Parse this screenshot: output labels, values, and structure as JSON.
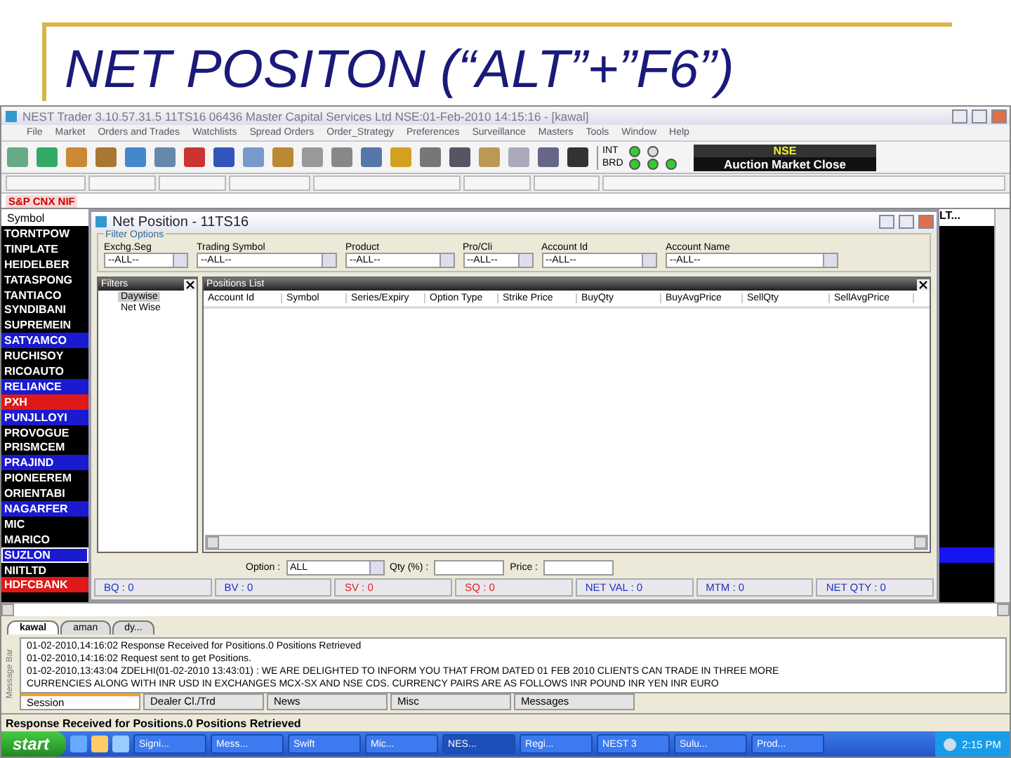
{
  "slide": {
    "title": "NET POSITON (“ALT”+”F6”)"
  },
  "window": {
    "title": "NEST Trader 3.10.57.31.5 11TS16 06436 Master Capital Services Ltd NSE:01-Feb-2010 14:15:16 - [kawal]"
  },
  "menu": [
    "File",
    "Market",
    "Orders and Trades",
    "Watchlists",
    "Spread Orders",
    "Order_Strategy",
    "Preferences",
    "Surveillance",
    "Masters",
    "Tools",
    "Window",
    "Help"
  ],
  "exchange_status": {
    "lights": [
      {
        "label": "INT",
        "lamps": [
          {
            "on": true
          },
          {
            "on": false
          }
        ]
      },
      {
        "label": "BRD",
        "lamps": [
          {
            "on": true
          },
          {
            "on": true
          },
          {
            "on": true
          }
        ]
      }
    ],
    "exchange": "NSE",
    "market_state": "Auction Market Close"
  },
  "ticker": "S&P CNX NIF",
  "market_watch": {
    "header": "Symbol",
    "right_header": "LT...",
    "rows": [
      {
        "symbol": "TORNTPOW",
        "color": "#000000",
        "selected": false
      },
      {
        "symbol": "TINPLATE",
        "color": "#000000",
        "selected": false
      },
      {
        "symbol": "HEIDELBER",
        "color": "#000000",
        "selected": false
      },
      {
        "symbol": "TATASPONG",
        "color": "#000000",
        "selected": false
      },
      {
        "symbol": "TANTIACO",
        "color": "#000000",
        "selected": false
      },
      {
        "symbol": "SYNDIBANI",
        "color": "#000000",
        "selected": false
      },
      {
        "symbol": "SUPREMEIN",
        "color": "#000000",
        "selected": false
      },
      {
        "symbol": "SATYAMCO",
        "color": "#1a1ad0",
        "selected": false
      },
      {
        "symbol": "RUCHISOY",
        "color": "#000000",
        "selected": false
      },
      {
        "symbol": "RICOAUTO",
        "color": "#000000",
        "selected": false
      },
      {
        "symbol": "RELIANCE",
        "color": "#1a1ad0",
        "selected": false
      },
      {
        "symbol": "PXH",
        "color": "#e01818",
        "selected": false
      },
      {
        "symbol": "PUNJLLOYI",
        "color": "#1a1ad0",
        "selected": false
      },
      {
        "symbol": "PROVOGUE",
        "color": "#000000",
        "selected": false
      },
      {
        "symbol": "PRISMCEM",
        "color": "#000000",
        "selected": false
      },
      {
        "symbol": "PRAJIND",
        "color": "#1a1ad0",
        "selected": false
      },
      {
        "symbol": "PIONEEREM",
        "color": "#000000",
        "selected": false
      },
      {
        "symbol": "ORIENTABI",
        "color": "#000000",
        "selected": false
      },
      {
        "symbol": "NAGARFER",
        "color": "#1a1ad0",
        "selected": false
      },
      {
        "symbol": "MIC",
        "color": "#000000",
        "selected": false
      },
      {
        "symbol": "MARICO",
        "color": "#000000",
        "selected": false
      },
      {
        "symbol": "SUZLON",
        "color": "#1a1ad0",
        "selected": true
      },
      {
        "symbol": "NIITLTD",
        "color": "#000000",
        "selected": false
      },
      {
        "symbol": "HDFCBANK",
        "color": "#e01818",
        "selected": false
      }
    ]
  },
  "dialog": {
    "title": "Net Position - 11TS16",
    "filter_group": "Filter Options",
    "filters": [
      {
        "label": "Exchg.Seg",
        "value": "--ALL--"
      },
      {
        "label": "Trading Symbol",
        "value": "--ALL--"
      },
      {
        "label": "Product",
        "value": "--ALL--"
      },
      {
        "label": "Pro/Cli",
        "value": "--ALL--"
      },
      {
        "label": "Account Id",
        "value": "--ALL--"
      },
      {
        "label": "Account Name",
        "value": "--ALL--"
      }
    ],
    "filters_panel": {
      "title": "Filters",
      "items": [
        {
          "label": "Daywise",
          "selected": true
        },
        {
          "label": "Net Wise",
          "selected": false
        }
      ]
    },
    "positions": {
      "title": "Positions List",
      "columns": [
        "Account Id",
        "Symbol",
        "Series/Expiry",
        "Option Type",
        "Strike Price",
        "BuyQty",
        "BuyAvgPrice",
        "SellQty",
        "SellAvgPrice"
      ]
    },
    "option": {
      "label": "Option :",
      "value": "ALL"
    },
    "qty": {
      "label": "Qty (%) :"
    },
    "price": {
      "label": "Price :"
    },
    "totals": [
      {
        "text": "BQ : 0",
        "color": "#2030c0"
      },
      {
        "text": "BV : 0",
        "color": "#2030c0"
      },
      {
        "text": "SV : 0",
        "color": "#e02020"
      },
      {
        "text": "SQ : 0",
        "color": "#e02020"
      },
      {
        "text": "NET VAL : 0",
        "color": "#2030c0"
      },
      {
        "text": "MTM : 0",
        "color": "#2030c0"
      },
      {
        "text": "NET QTY : 0",
        "color": "#2030c0"
      }
    ]
  },
  "watch_tabs": [
    {
      "label": "kawal",
      "selected": true
    },
    {
      "label": "aman",
      "selected": false
    },
    {
      "label": "dy...",
      "selected": false
    }
  ],
  "message_bar": {
    "label": "Message Bar",
    "lines": [
      "01-02-2010,14:16:02     Response Received for Positions.0 Positions Retrieved",
      "01-02-2010,14:16:02     Request sent to get Positions.",
      "01-02-2010,13:43:04     ZDELHI(01-02-2010 13:43:01) : WE ARE DELIGHTED TO INFORM YOU THAT FROM DATED 01 FEB 2010 CLIENTS CAN TRADE IN THREE MORE",
      "CURRENCIES ALONG WITH INR USD IN EXCHANGES MCX-SX AND NSE CDS. CURRENCY PAIRS ARE AS FOLLOWS INR POUND INR YEN INR EURO"
    ],
    "tabs": [
      {
        "label": "Session",
        "selected": true
      },
      {
        "label": "Dealer Cl./Trd",
        "selected": false
      },
      {
        "label": "News",
        "selected": false
      },
      {
        "label": "Misc",
        "selected": false
      },
      {
        "label": "Messages",
        "selected": false
      }
    ]
  },
  "status_bar": "Response Received for Positions.0 Positions Retrieved",
  "taskbar": {
    "start": "start",
    "buttons": [
      {
        "label": "Signi...",
        "selected": false
      },
      {
        "label": "Mess...",
        "selected": false
      },
      {
        "label": "Swift",
        "selected": false
      },
      {
        "label": "Mic...",
        "selected": false
      },
      {
        "label": "NES...",
        "selected": true
      },
      {
        "label": "Regi...",
        "selected": false
      },
      {
        "label": "NEST 3",
        "selected": false
      },
      {
        "label": "Sulu...",
        "selected": false
      },
      {
        "label": "Prod...",
        "selected": false
      }
    ],
    "clock": "2:15 PM"
  }
}
